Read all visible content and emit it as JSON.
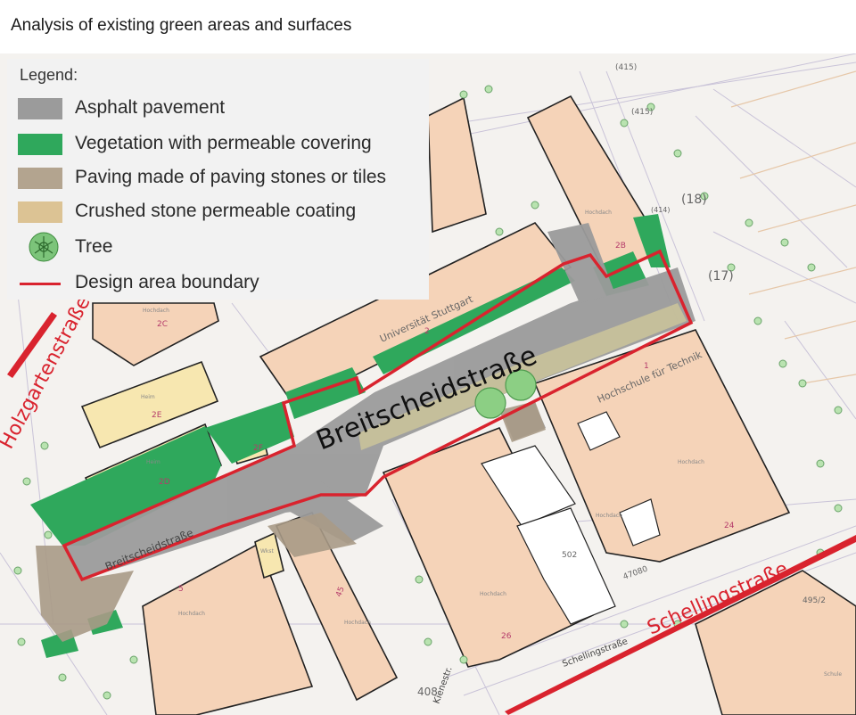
{
  "page_title": "Analysis of existing green areas and surfaces",
  "legend": {
    "title": "Legend:",
    "items": [
      {
        "key": "asphalt",
        "label": "Asphalt pavement",
        "color": "#9b9b9b"
      },
      {
        "key": "vegetation",
        "label": "Vegetation with permeable covering",
        "color": "#2fa85c"
      },
      {
        "key": "paving",
        "label": "Paving made of paving stones or tiles",
        "color": "#b3a48f"
      },
      {
        "key": "crushed",
        "label": "Crushed stone permeable coating",
        "color": "#dcc394"
      },
      {
        "key": "tree",
        "label": "Tree",
        "color": "#6fbf6f",
        "icon": "tree-icon"
      },
      {
        "key": "boundary",
        "label": "Design area boundary",
        "color": "#d9232e"
      }
    ]
  },
  "map": {
    "street_main": "Breitscheidstraße",
    "street_small": "Breitscheidstraße",
    "street_holzgarten": "Holzgartenstraße",
    "street_schelling": "Schellingstraße",
    "street_schelling_small": "Schellingstraße",
    "street_kiene": "Kienestr.",
    "building_uni": "Universität Stuttgart",
    "building_hft": "Hochschule für Technik",
    "building_labels": [
      "2B",
      "2C",
      "2E",
      "2D",
      "2F",
      "2",
      "1",
      "5",
      "45",
      "24",
      "26",
      "502",
      "495/2"
    ],
    "parcel_numbers": [
      "(415)",
      "(415)",
      "(18)",
      "(17)",
      "(414)",
      "408",
      "47080"
    ],
    "small_labels": [
      "Hochdach",
      "Hochdach",
      "Heim",
      "Heim",
      "Hochdach",
      "Hochdach",
      "Hochdach",
      "Hochdach",
      "Wkst",
      "Hochdach",
      "Schule"
    ],
    "colors": {
      "building": "#f5d3b8",
      "building_stroke": "#222222",
      "asphalt": "#9b9b9b",
      "vegetation": "#2fa85c",
      "paving": "#a89a86",
      "crushed": "#c9c29a",
      "yellow_bldg": "#f7e7b0",
      "boundary": "#d9232e",
      "background": "#f4f2ef"
    }
  }
}
